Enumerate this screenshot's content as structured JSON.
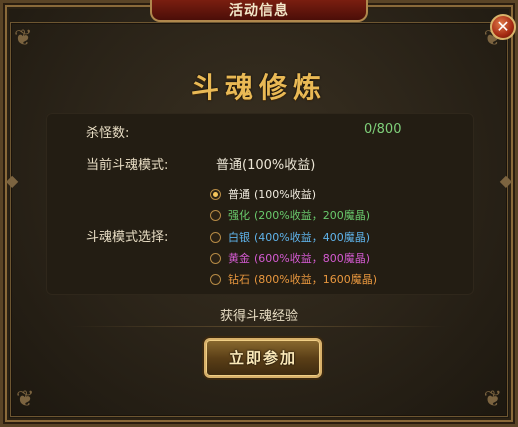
{
  "window": {
    "title": "活动信息",
    "close_icon": "close-x"
  },
  "heading": "斗魂修炼",
  "kills": {
    "label": "杀怪数:",
    "value": "0/800"
  },
  "current_mode": {
    "label": "当前斗魂模式:",
    "value": "普通(100%收益)"
  },
  "mode_select": {
    "label": "斗魂模式选择:",
    "options": [
      {
        "name": "普通",
        "detail": "(100%收益)",
        "selected": true
      },
      {
        "name": "强化",
        "detail": "(200%收益，200魔晶)",
        "selected": false
      },
      {
        "name": "白银",
        "detail": "(400%收益，400魔晶)",
        "selected": false
      },
      {
        "name": "黄金",
        "detail": "(600%收益，800魔晶)",
        "selected": false
      },
      {
        "name": "钻石",
        "detail": "(800%收益，1600魔晶)",
        "selected": false
      }
    ]
  },
  "gain_text": "获得斗魂经验",
  "join_button": "立即参加",
  "colors": {
    "title_bar": "#6a1a0e",
    "heading_gold": "#e9b955",
    "kill_value": "#7fd07a",
    "opt_strengthen": "#69c96c",
    "opt_silver": "#5fb3ea",
    "opt_gold": "#d35ad0",
    "opt_diamond": "#e8973e"
  }
}
